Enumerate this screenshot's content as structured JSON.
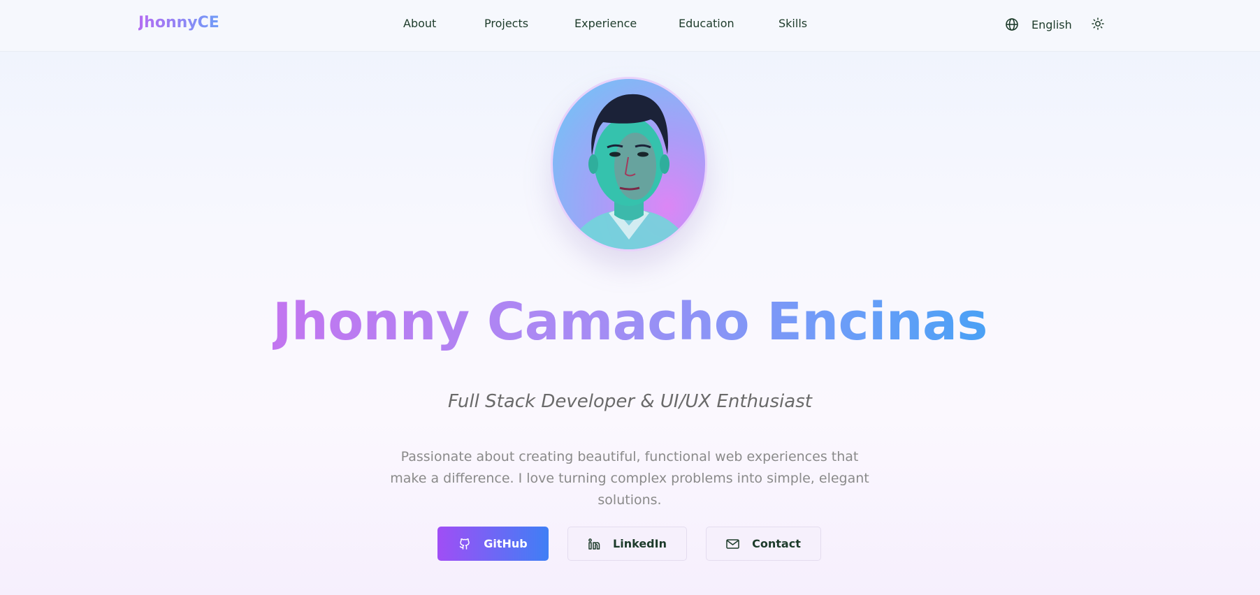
{
  "header": {
    "logo": "JhonnyCE",
    "nav": [
      {
        "label": "About"
      },
      {
        "label": "Projects"
      },
      {
        "label": "Experience"
      },
      {
        "label": "Education"
      },
      {
        "label": "Skills"
      }
    ],
    "language_label": "English",
    "language_icon": "globe-icon",
    "theme_icon": "sun-icon"
  },
  "hero": {
    "name": "Jhonny Camacho Encinas",
    "role": "Full Stack Developer & UI/UX Enthusiast",
    "description": "Passionate about creating beautiful, functional web experiences that make a difference. I love turning complex problems into simple, elegant solutions.",
    "buttons": {
      "github": {
        "label": "GitHub",
        "icon": "github-icon"
      },
      "linkedin": {
        "label": "LinkedIn",
        "icon": "linkedin-icon"
      },
      "contact": {
        "label": "Contact",
        "icon": "mail-icon"
      }
    }
  },
  "colors": {
    "accent_purple": "#a04ef5",
    "accent_blue": "#3f7ff5",
    "nav_text": "#1d3b2a"
  }
}
